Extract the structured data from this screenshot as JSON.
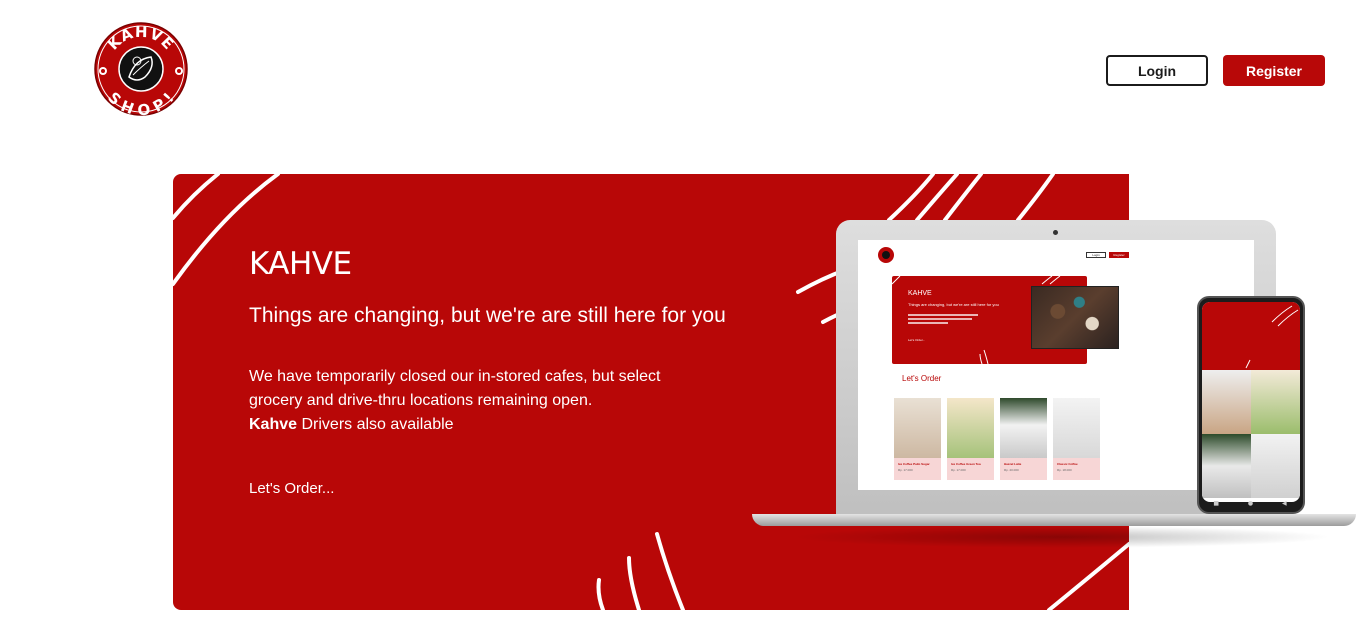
{
  "brand": {
    "logo_top_text": "KAHVE",
    "logo_bottom_text": "SHOP!"
  },
  "header": {
    "login_label": "Login",
    "register_label": "Register"
  },
  "hero": {
    "title": "KAHVE",
    "subtitle": "Things are changing, but we're are still here for you",
    "body_line1": "We have temporarily closed our in-stored cafes, but select",
    "body_line2": "grocery and drive-thru locations remaining open.",
    "body_brand": "Kahve",
    "body_line3": " Drivers also available",
    "cta": "Let's Order..."
  },
  "mockup": {
    "login_label": "Login",
    "register_label": "Register",
    "hero_title": "KAHVE",
    "hero_subtitle": "Things are changing, but we're are still here for you",
    "hero_cta": "Let's Order...",
    "order_heading": "Let's Order",
    "products": [
      {
        "name": "Ice Coffee Palm Sugar",
        "price": "Rp. 17.000"
      },
      {
        "name": "Ice Coffee Green Tea",
        "price": "Rp. 17.000"
      },
      {
        "name": "Hazzel Latte",
        "price": "Rp. 20.000"
      },
      {
        "name": "Classic Coffee",
        "price": "Rp. 18.000"
      }
    ]
  },
  "colors": {
    "brand_red": "#b80707",
    "text_dark": "#1b1b1b",
    "card_pink": "#f7d6d6"
  }
}
